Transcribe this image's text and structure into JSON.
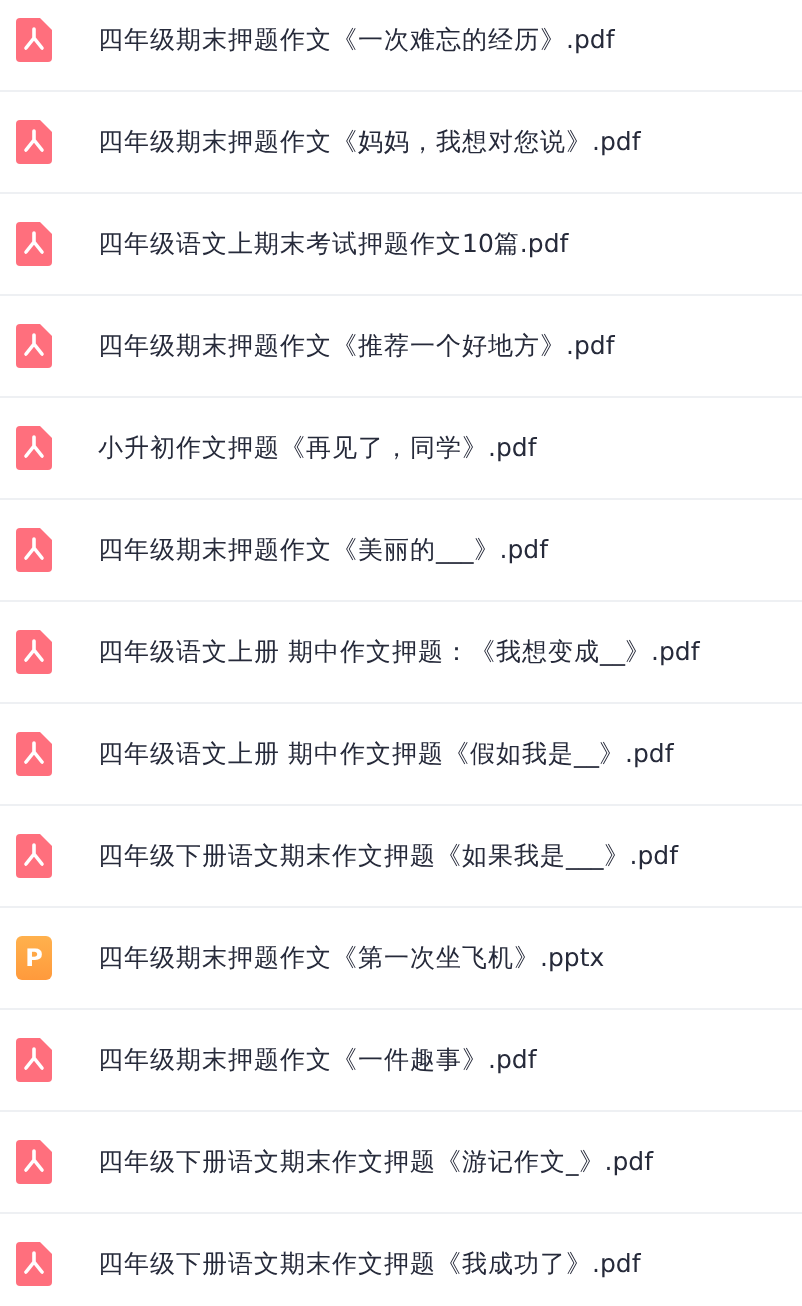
{
  "files": [
    {
      "kind": "pdf",
      "name": "四年级期末押题作文《一次难忘的经历》.pdf"
    },
    {
      "kind": "pdf",
      "name": "四年级期末押题作文《妈妈，我想对您说》.pdf"
    },
    {
      "kind": "pdf",
      "name": "四年级语文上期末考试押题作文10篇.pdf"
    },
    {
      "kind": "pdf",
      "name": "四年级期末押题作文《推荐一个好地方》.pdf"
    },
    {
      "kind": "pdf",
      "name": "小升初作文押题《再见了，同学》.pdf"
    },
    {
      "kind": "pdf",
      "name": "四年级期末押题作文《美丽的___》.pdf"
    },
    {
      "kind": "pdf",
      "name": "四年级语文上册 期中作文押题：《我想变成__》.pdf"
    },
    {
      "kind": "pdf",
      "name": "四年级语文上册 期中作文押题《假如我是__》.pdf"
    },
    {
      "kind": "pdf",
      "name": "四年级下册语文期末作文押题《如果我是___》.pdf"
    },
    {
      "kind": "pptx",
      "icon_letter": "P",
      "name": "四年级期末押题作文《第一次坐飞机》.pptx"
    },
    {
      "kind": "pdf",
      "name": "四年级期末押题作文《一件趣事》.pdf"
    },
    {
      "kind": "pdf",
      "name": "四年级下册语文期末作文押题《游记作文_》.pdf"
    },
    {
      "kind": "pdf",
      "name": "四年级下册语文期末作文押题《我成功了》.pdf"
    }
  ]
}
